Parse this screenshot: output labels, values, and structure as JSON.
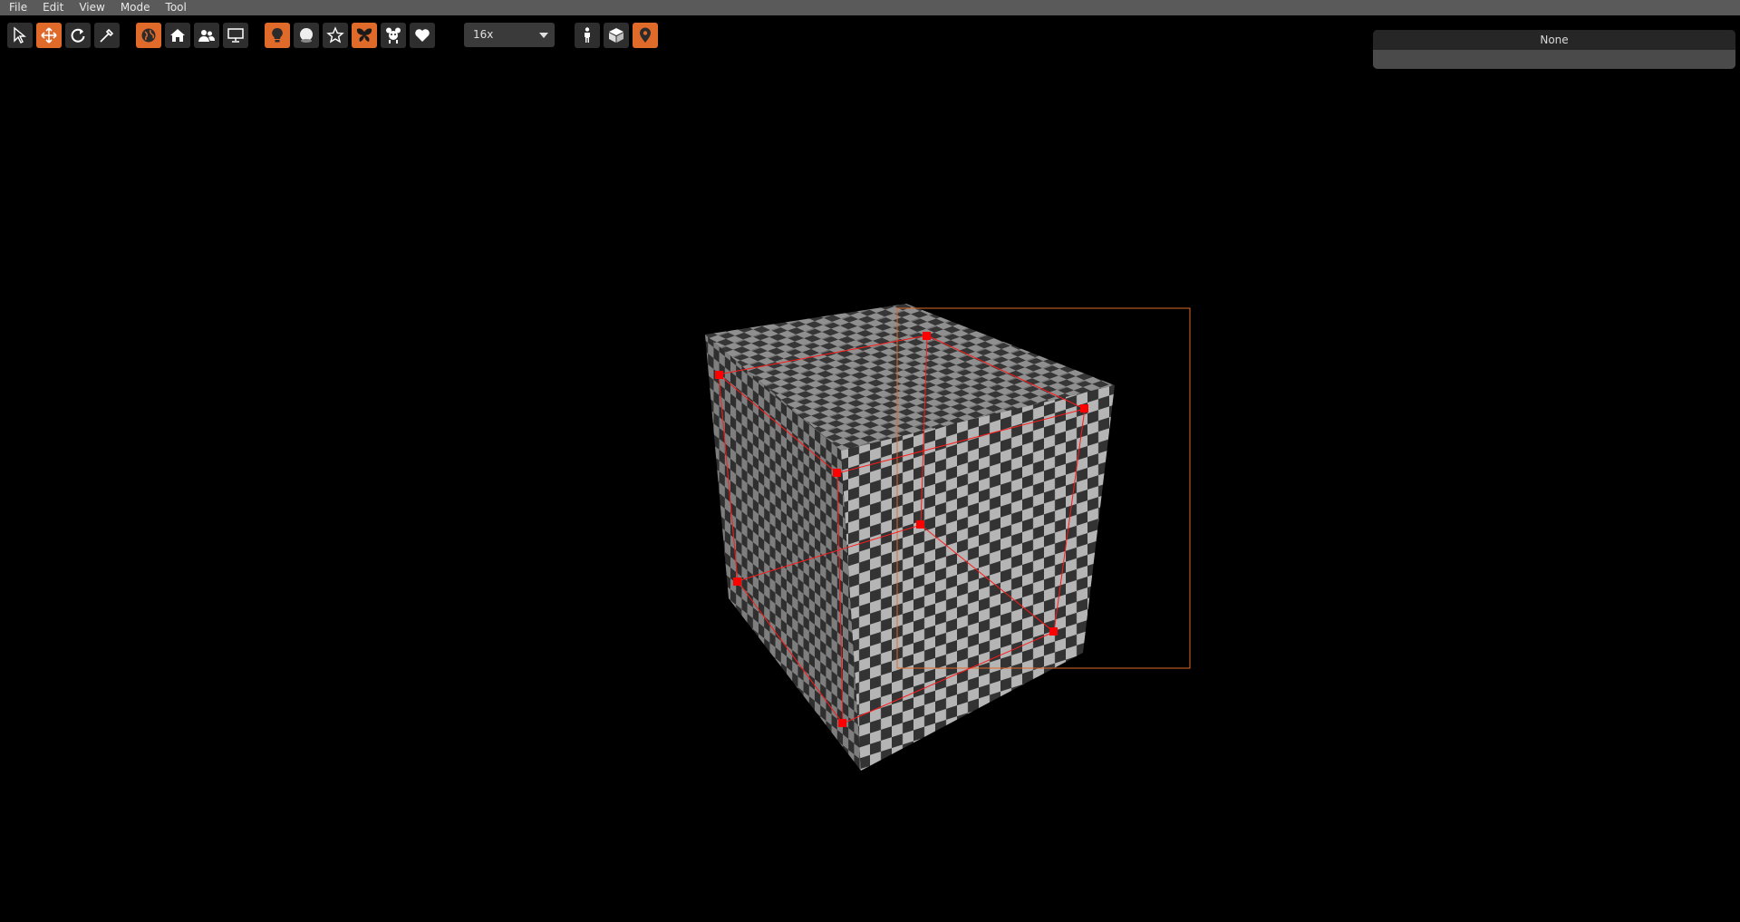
{
  "menu": {
    "items": [
      "File",
      "Edit",
      "View",
      "Mode",
      "Tool"
    ]
  },
  "toolbar": {
    "select_tool": "select-arrow-icon",
    "move_tool": "move-arrows-icon",
    "rotate_tool": "rotate-icon",
    "paint_tool": "eyedropper-icon",
    "world_view": "globe-icon",
    "home_view": "home-icon",
    "people_view": "users-icon",
    "screen_view": "monitor-icon",
    "light": "lightbulb-icon",
    "sphere": "sphere-icon",
    "star": "star-icon",
    "butterfly": "butterfly-icon",
    "character": "bear-icon",
    "heart": "heart-icon",
    "person": "person-icon",
    "box": "cube-icon",
    "pin": "map-pin-icon",
    "zoom": {
      "value": "16x"
    }
  },
  "info_panel": {
    "title": "None"
  },
  "colors": {
    "menubar": "#5a5a5a",
    "accent": "#e06a2a",
    "button": "#2e2e2e",
    "selection": "#ff0000"
  }
}
